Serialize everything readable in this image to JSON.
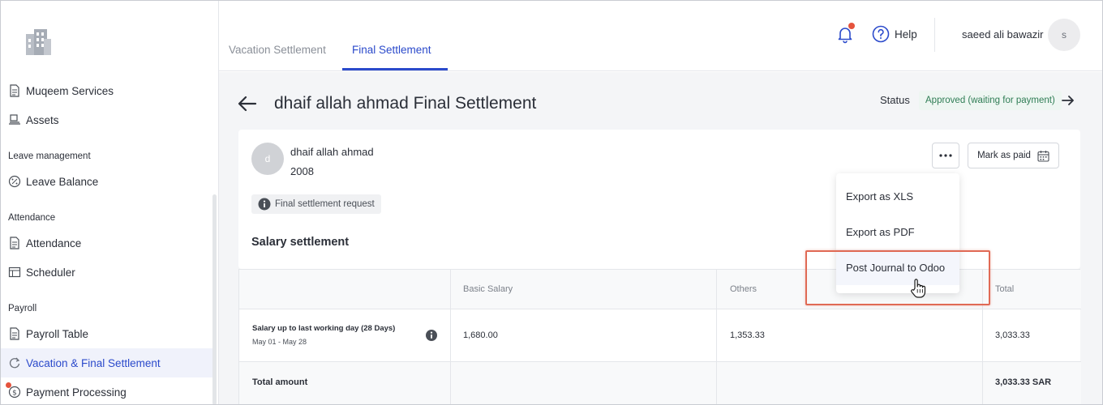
{
  "sidebar": {
    "items": [
      {
        "label": "Muqeem Services"
      },
      {
        "label": "Assets"
      },
      {
        "label": "Leave Balance"
      },
      {
        "label": "Attendance"
      },
      {
        "label": "Scheduler"
      },
      {
        "label": "Payroll Table"
      },
      {
        "label": "Vacation & Final Settlement"
      },
      {
        "label": "Payment Processing"
      }
    ],
    "sections": {
      "leave": "Leave management",
      "attendance": "Attendance",
      "payroll": "Payroll"
    }
  },
  "header": {
    "tabs": [
      {
        "label": "Vacation Settlement"
      },
      {
        "label": "Final Settlement"
      }
    ],
    "help_label": "Help",
    "user_name": "saeed ali bawazir",
    "user_initial": "s"
  },
  "page": {
    "title": "dhaif allah ahmad Final Settlement",
    "status_label": "Status",
    "status_value": "Approved (waiting for payment)"
  },
  "employee": {
    "initial": "d",
    "name": "dhaif allah ahmad",
    "id": "2008",
    "chip": "Final settlement request"
  },
  "actions": {
    "mark_paid": "Mark as paid"
  },
  "dropdown": {
    "items": [
      {
        "label": "Export as XLS"
      },
      {
        "label": "Export as PDF"
      },
      {
        "label": "Post Journal to Odoo"
      }
    ]
  },
  "salary": {
    "section_title": "Salary settlement",
    "columns": [
      "",
      "Basic Salary",
      "Others",
      "Total"
    ],
    "rows": [
      {
        "label": "Salary up to last working day (28 Days)",
        "sub": "May 01 - May 28",
        "basic": "1,680.00",
        "others": "1,353.33",
        "total": "3,033.33"
      }
    ],
    "total_label": "Total amount",
    "total_value": "3,033.33 SAR"
  },
  "colors": {
    "accent": "#2b4acb",
    "status_green": "#2f7d55",
    "highlight": "#e06a55",
    "notification": "#e5533d"
  }
}
